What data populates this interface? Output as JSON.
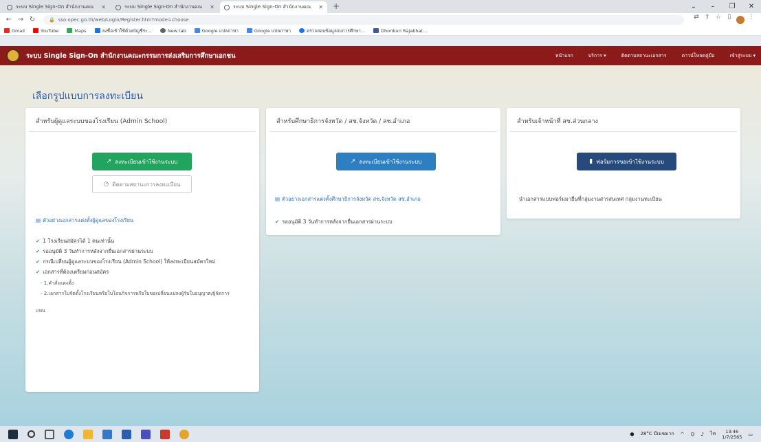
{
  "browser": {
    "tabs": [
      {
        "title": "ระบบ Single Sign-On สำนักงานคณ",
        "active": false
      },
      {
        "title": "ระบบ Single Sign-On สำนักงานคณ",
        "active": false
      },
      {
        "title": "ระบบ Single Sign-On สำนักงานคณ",
        "active": true
      }
    ],
    "new_tab": "+",
    "url": "sso.opec.go.th/web/Login/Register.htm?mode=choose",
    "bookmarks": [
      {
        "label": "Gmail",
        "color": "#d93025"
      },
      {
        "label": "YouTube",
        "color": "#ff0000"
      },
      {
        "label": "Maps",
        "color": "#34a853"
      },
      {
        "label": "ลงชื่อเข้าใช้ด้วยบัญชีระ...",
        "color": "#1a73e8"
      },
      {
        "label": "New tab",
        "color": "#5f6368"
      },
      {
        "label": "Google แปลภาษา",
        "color": "#4285f4"
      },
      {
        "label": "Google แปลภาษา",
        "color": "#4285f4"
      },
      {
        "label": "ตรวจสอบข้อมูลจบการศึกษา...",
        "color": "#1a73e8"
      },
      {
        "label": "Dhonburi Rajabhat...",
        "color": "#3c5a9a"
      }
    ]
  },
  "navbar": {
    "brand": "ระบบ Single Sign-On สำนักงานคณะกรรมการส่งเสริมการศึกษาเอกชน",
    "menu": [
      "หน้าแรก",
      "บริการ ▾",
      "ติดตามสถานะเอกสาร",
      "ดาวน์โหลดคู่มือ",
      "เข้าสู่ระบบ ▾"
    ]
  },
  "page": {
    "title": "เลือกรูปแบบการลงทะเบียน"
  },
  "card1": {
    "header": "สำหรับผู้ดูแลระบบของโรงเรียน (Admin School)",
    "register_button": "ลงทะเบียนเข้าใช้งานระบบ",
    "status_button": "ติดตามสถานะการลงทะเบียน",
    "doc_link": "ตัวอย่างเอกสารแต่งตั้งผู้ดูแลของโรงเรียน",
    "items": [
      "1 โรงเรียนสมัครได้ 1 คนเท่านั้น",
      "รออนุมัติ 3 วันทำการหลังจากยื่นเอกสารผ่านระบบ",
      "กรณีเปลี่ยนผู้ดูแลระบบของโรงเรียน (Admin School) ให้ลงทะเบียนสมัครใหม่",
      "เอกสารที่ต้องเตรียมก่อนสมัคร"
    ],
    "subitems": [
      "- 1.คำสั่งแต่งตั้ง",
      "- 2.เอกสารใบจัดตั้งโรงเรียนหรือใบโอนกิจการหรือใบขอเปลี่ยนแปลงผู้รับใบอนุญาต/ผู้จัดการ",
      "แทน"
    ]
  },
  "card2": {
    "header": "สำหรับศึกษาธิการจังหวัด / สช.จังหวัด / สช.อำเภอ",
    "register_button": "ลงทะเบียนเข้าใช้งานระบบ",
    "doc_link": "ตัวอย่างเอกสารแต่งตั้งศึกษาธิการจังหวัด สช.จังหวัด สช.อำเภอ",
    "items": [
      "รออนุมัติ 3 วันทำการหลังจากยื่นเอกสารผ่านระบบ"
    ]
  },
  "card3": {
    "header": "สำหรับเจ้าหน้าที่ สช.ส่วนกลาง",
    "form_button": "ฟอร์มการขอเข้าใช้งานระบบ",
    "note": "นำเอกสารแบบฟอร์มมายื่นที่กลุ่มงานสารสนเทศ กลุ่มงานทะเบียน"
  },
  "taskbar": {
    "weather": "28°C มีเมฆมาก",
    "lang": "ไท",
    "time": "13:46",
    "date": "1/7/2565"
  },
  "colors": {
    "navbar": "#8b1a1a",
    "title": "#2b5aa6",
    "green": "#20a45e",
    "blue": "#2e7fc2",
    "navy": "#264a7c"
  }
}
